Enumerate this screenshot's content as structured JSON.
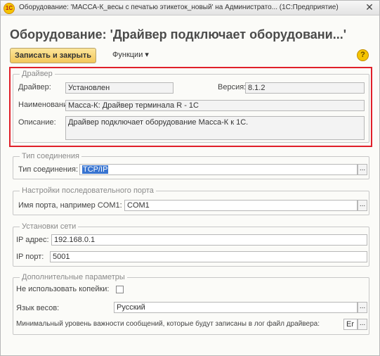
{
  "window": {
    "title": "Оборудование: 'МАССА-К_весы с печатью этикеток_новый' на Администрато... (1С:Предприятие)",
    "app_icon": "1С",
    "close": "✕"
  },
  "form": {
    "title": "Оборудование: 'Драйвер подключает оборудовани...'"
  },
  "toolbar": {
    "save_close": "Записать и закрыть",
    "functions": "Функции ▾",
    "help": "?"
  },
  "driver": {
    "legend": "Драйвер",
    "driver_label": "Драйвер:",
    "driver_value": "Установлен",
    "version_label": "Версия:",
    "version_value": "8.1.2",
    "name_label": "Наименование:",
    "name_value": "Масса-К: Драйвер терминала R - 1С",
    "desc_label": "Описание:",
    "desc_value": "Драйвер подключает оборудование Масса-К к 1С."
  },
  "connection": {
    "legend": "Тип соединения",
    "type_label": "Тип соединения:",
    "type_value": "TCP/IP"
  },
  "serial": {
    "legend": "Настройки последовательного порта",
    "port_label": "Имя порта, например COM1:",
    "port_value": "COM1"
  },
  "network": {
    "legend": "Установки сети",
    "ip_label": "IP адрес:",
    "ip_value": "192.168.0.1",
    "port_label": "IP порт:",
    "port_value": "5001"
  },
  "extra": {
    "legend": "Дополнительные параметры",
    "kopeck_label": "Не использовать копейки:",
    "lang_label": "Язык весов:",
    "lang_value": "Русский",
    "log_label": "Минимальный уровень важности сообщений, которые будут записаны в лог файл драйвера:",
    "log_value": "Er"
  },
  "ellipsis": "..."
}
